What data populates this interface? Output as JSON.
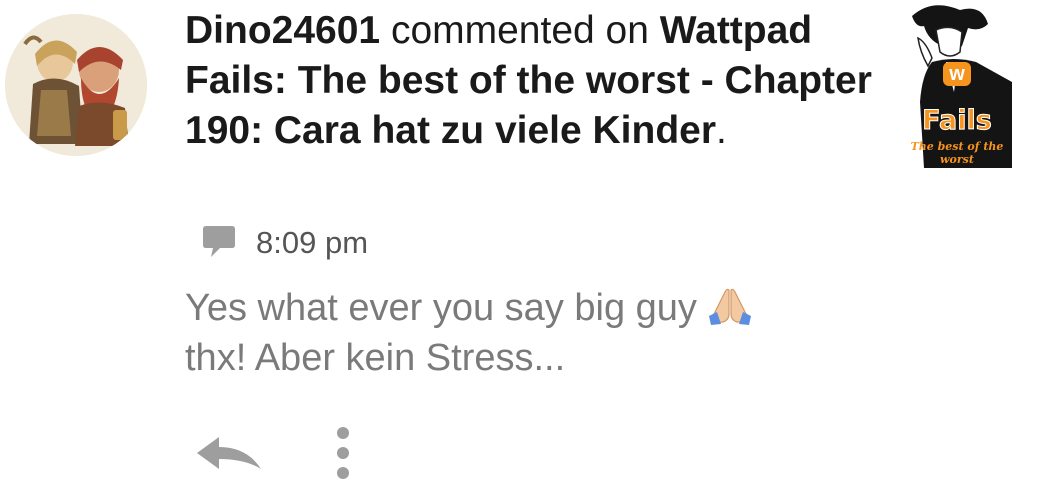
{
  "notification": {
    "username": "Dino24601",
    "action": " commented on ",
    "story_title": "Wattpad Fails: The best of the worst - Chapter 190: Cara hat zu viele Kinder",
    "title_end": ".",
    "timestamp": "8:09 pm",
    "reply_line": "Yes what ever you say big guy",
    "message": "thx! Aber kein Stress..."
  },
  "cover": {
    "logo_letter": "w",
    "title": "Fails",
    "subtitle": "The best of the worst"
  },
  "icons": {
    "comment": "speech-bubble",
    "emoji": "folded-hands",
    "reply": "reply-arrow",
    "more": "vertical-ellipsis"
  },
  "colors": {
    "accent": "#f7941d",
    "icon_gray": "#9e9e9e"
  }
}
